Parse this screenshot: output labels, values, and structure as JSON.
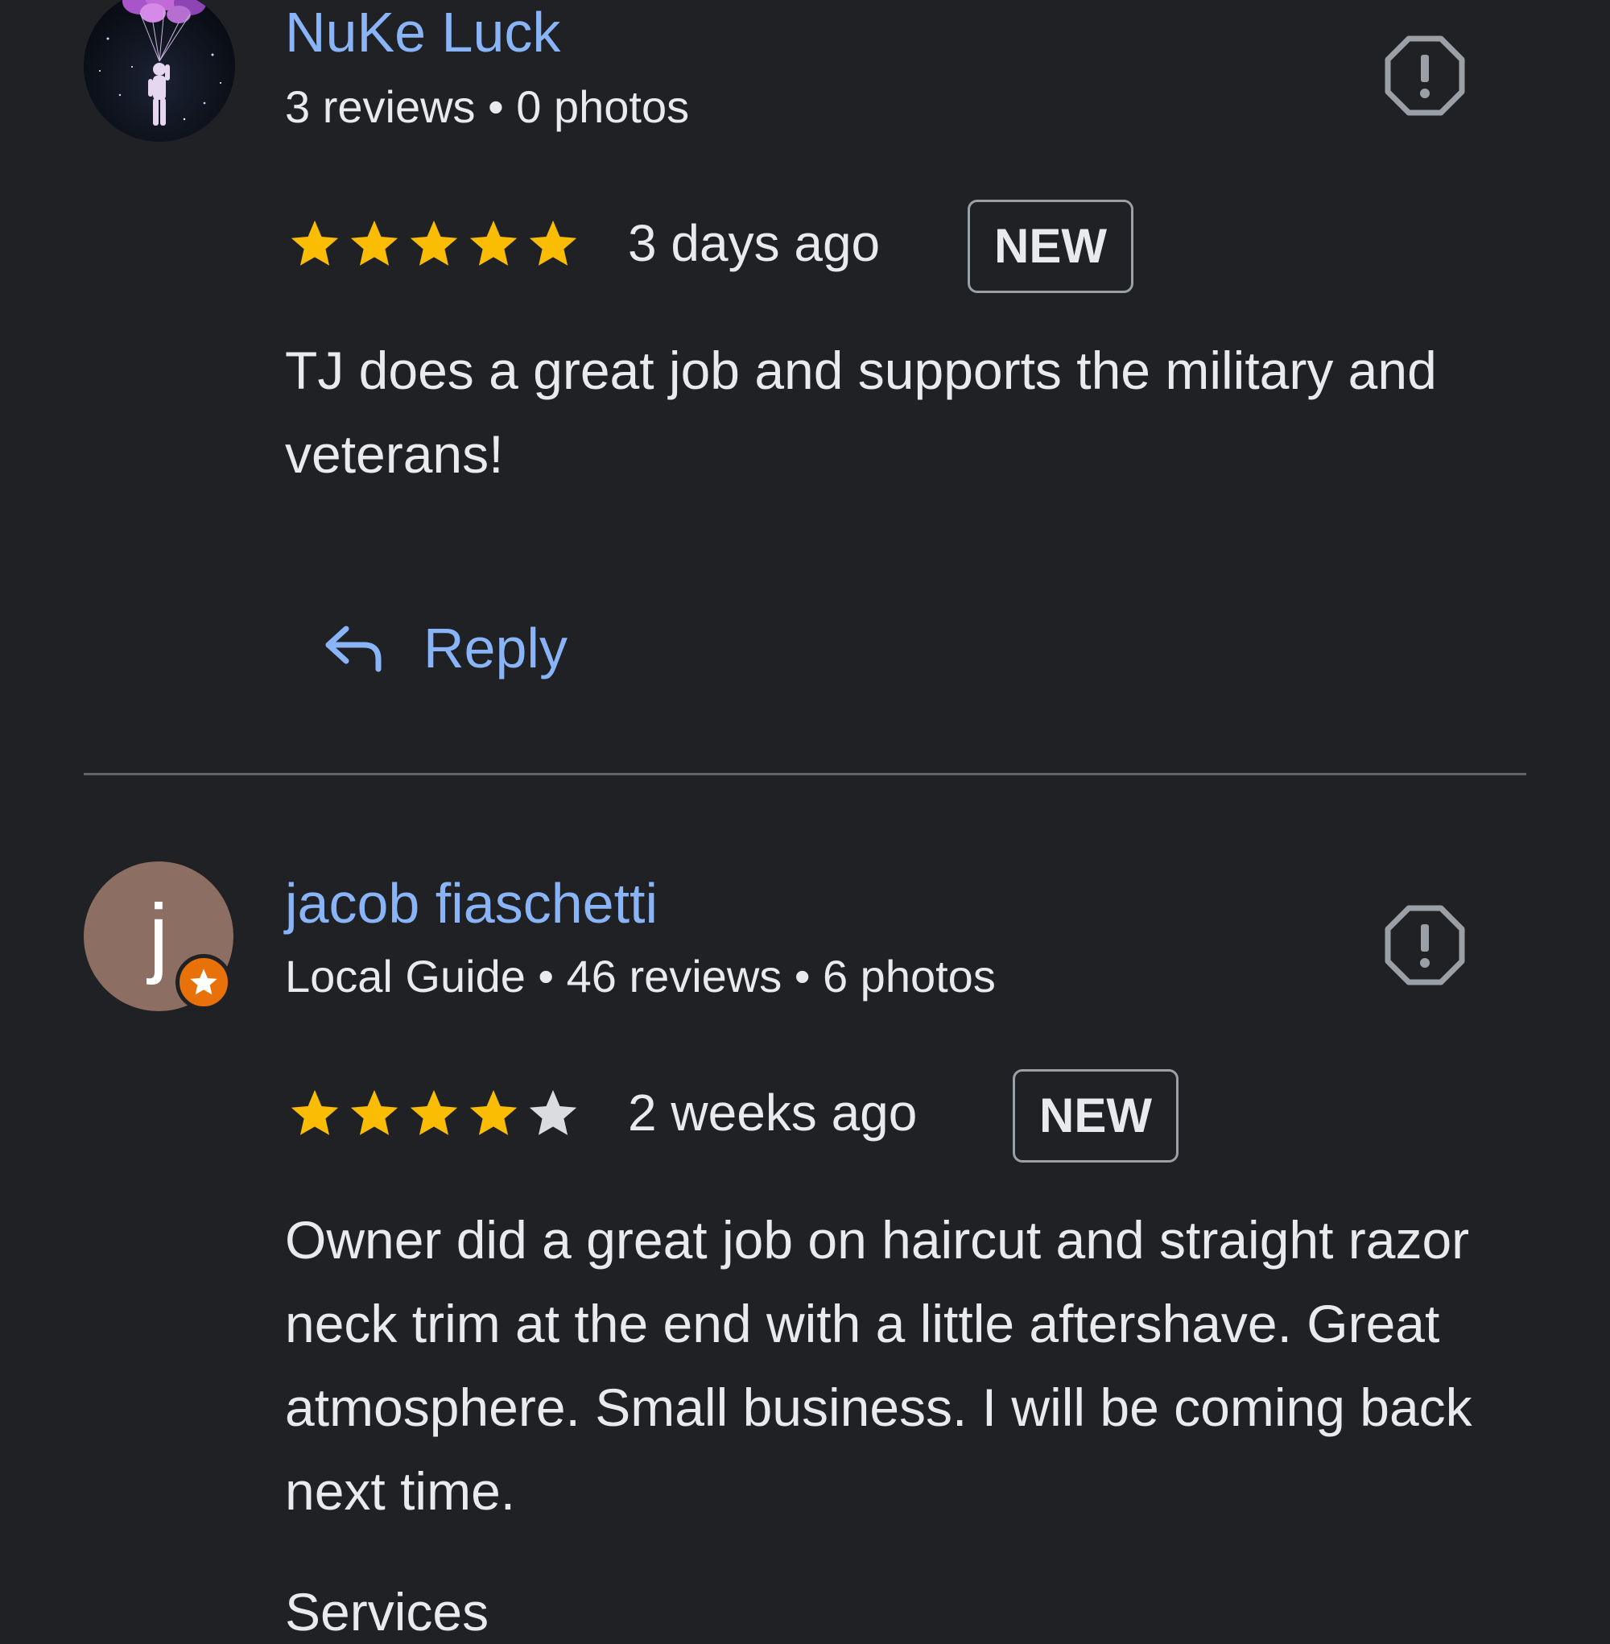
{
  "reviews": [
    {
      "name": "NuKe Luck",
      "meta": "3 reviews • 0 photos",
      "rating": 5,
      "time": "3 days ago",
      "badge": "NEW",
      "text": "TJ does a great job and supports the military and veterans!",
      "reply_label": "Reply",
      "avatar": "astronaut-balloons-photo"
    },
    {
      "name": "jacob fiaschetti",
      "avatar_letter": "j",
      "meta": "Local Guide • 46 reviews • 6 photos",
      "rating": 4,
      "time": "2 weeks ago",
      "badge": "NEW",
      "text": "Owner did a great job on haircut and straight razor neck trim at the end with a little aftershave. Great atmosphere. Small business. I will be coming back next time.",
      "avatar_color": "#8d6e63",
      "badge_color": "#e8710a"
    }
  ],
  "next_section_label": "Services",
  "colors": {
    "background": "#202124",
    "link": "#8ab4f8",
    "star_filled": "#fbbc04",
    "star_empty": "#dadce0",
    "divider": "#5f6368"
  },
  "icons": {
    "report": "report-icon",
    "reply": "reply-icon",
    "star": "star-icon",
    "local_guide": "local-guide-star-icon"
  }
}
